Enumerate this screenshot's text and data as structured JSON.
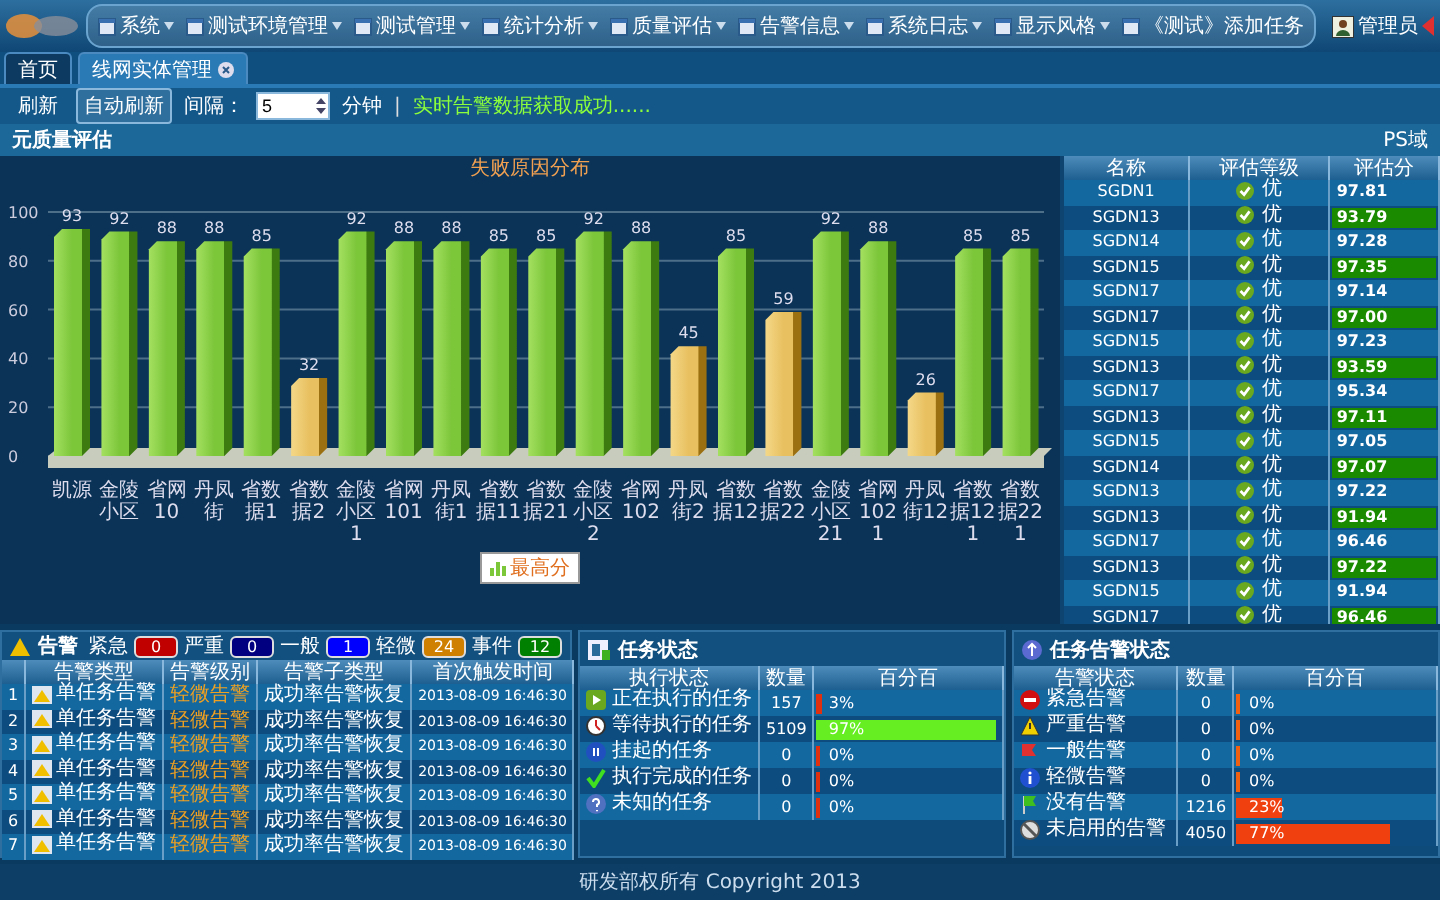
{
  "header": {
    "menu": [
      {
        "label": "系统",
        "dropdown": true
      },
      {
        "label": "测试环境管理",
        "dropdown": true
      },
      {
        "label": "测试管理",
        "dropdown": true
      },
      {
        "label": "统计分析",
        "dropdown": true
      },
      {
        "label": "质量评估",
        "dropdown": true
      },
      {
        "label": "告警信息",
        "dropdown": true
      },
      {
        "label": "系统日志",
        "dropdown": true
      },
      {
        "label": "显示风格",
        "dropdown": true
      },
      {
        "label": "《测试》添加任务",
        "dropdown": false
      }
    ],
    "user": "管理员"
  },
  "tabs": [
    {
      "label": "首页",
      "selected": false,
      "closable": false
    },
    {
      "label": "线网实体管理",
      "selected": true,
      "closable": true
    }
  ],
  "toolbar": {
    "refresh": "刷新",
    "auto_refresh": "自动刷新",
    "interval_label": "间隔：",
    "interval_value": "5",
    "unit": "分钟",
    "separator": "|",
    "status": "实时告警数据获取成功......"
  },
  "quality": {
    "title": "元质量评估",
    "domain": "PS域",
    "chart_data": {
      "type": "bar",
      "title": "失败原因分布",
      "categories": [
        "凯源",
        "金陵小区",
        "省网10",
        "丹凤街",
        "省数据1",
        "省数据2",
        "金陵小区1",
        "省网101",
        "丹凤街1",
        "省数据11",
        "省数据21",
        "金陵小区2",
        "省网102",
        "丹凤街2",
        "省数据12",
        "省数据22",
        "金陵小区21",
        "省网1021",
        "丹凤街12",
        "省数据121",
        "省数据221"
      ],
      "series": [
        {
          "name": "最高分",
          "color": "#7cc63a",
          "values": [
            93,
            92,
            88,
            88,
            85,
            null,
            92,
            88,
            88,
            85,
            85,
            92,
            88,
            null,
            85,
            null,
            92,
            88,
            null,
            85,
            85
          ]
        },
        {
          "color": "#e8c060",
          "values": [
            null,
            null,
            null,
            null,
            null,
            32,
            null,
            null,
            null,
            null,
            null,
            null,
            null,
            45,
            null,
            59,
            null,
            null,
            26,
            null,
            null
          ]
        }
      ],
      "ylim": [
        0,
        100
      ],
      "yticks": [
        0,
        20,
        40,
        60,
        80,
        100
      ],
      "grid": true,
      "data_labels": true
    },
    "table": {
      "columns": [
        "名称",
        "评估等级",
        "评估分"
      ],
      "rows": [
        {
          "name": "SGDN1",
          "grade": "优",
          "score": "97.81",
          "highlight": false
        },
        {
          "name": "SGDN13",
          "grade": "优",
          "score": "93.79",
          "highlight": true
        },
        {
          "name": "SGDN14",
          "grade": "优",
          "score": "97.28",
          "highlight": false
        },
        {
          "name": "SGDN15",
          "grade": "优",
          "score": "97.35",
          "highlight": true
        },
        {
          "name": "SGDN17",
          "grade": "优",
          "score": "97.14",
          "highlight": false
        },
        {
          "name": "SGDN17",
          "grade": "优",
          "score": "97.00",
          "highlight": true
        },
        {
          "name": "SGDN15",
          "grade": "优",
          "score": "97.23",
          "highlight": false
        },
        {
          "name": "SGDN13",
          "grade": "优",
          "score": "93.59",
          "highlight": true
        },
        {
          "name": "SGDN17",
          "grade": "优",
          "score": "95.34",
          "highlight": false
        },
        {
          "name": "SGDN13",
          "grade": "优",
          "score": "97.11",
          "highlight": true
        },
        {
          "name": "SGDN15",
          "grade": "优",
          "score": "97.05",
          "highlight": false
        },
        {
          "name": "SGDN14",
          "grade": "优",
          "score": "97.07",
          "highlight": true
        },
        {
          "name": "SGDN13",
          "grade": "优",
          "score": "97.22",
          "highlight": false
        },
        {
          "name": "SGDN13",
          "grade": "优",
          "score": "91.94",
          "highlight": true
        },
        {
          "name": "SGDN17",
          "grade": "优",
          "score": "96.46",
          "highlight": false
        },
        {
          "name": "SGDN13",
          "grade": "优",
          "score": "97.22",
          "highlight": true
        },
        {
          "name": "SGDN15",
          "grade": "优",
          "score": "91.94",
          "highlight": false
        },
        {
          "name": "SGDN17",
          "grade": "优",
          "score": "96.46",
          "highlight": true
        }
      ]
    }
  },
  "alarms": {
    "title": "告警",
    "levels": [
      {
        "label": "紧急",
        "count": "0",
        "color": "#c00000"
      },
      {
        "label": "严重",
        "count": "0",
        "color": "#000080"
      },
      {
        "label": "一般",
        "count": "1",
        "color": "#0000ff"
      },
      {
        "label": "轻微",
        "count": "24",
        "color": "#d08000"
      },
      {
        "label": "事件",
        "count": "12",
        "color": "#008000"
      }
    ],
    "columns": [
      "告警类型",
      "告警级别",
      "告警子类型",
      "首次触发时间"
    ],
    "rows": [
      {
        "index": "1",
        "type": "单任务告警",
        "level": "轻微告警",
        "subtype": "成功率告警恢复",
        "time": "2013-08-09 16:46:30"
      },
      {
        "index": "2",
        "type": "单任务告警",
        "level": "轻微告警",
        "subtype": "成功率告警恢复",
        "time": "2013-08-09 16:46:30"
      },
      {
        "index": "3",
        "type": "单任务告警",
        "level": "轻微告警",
        "subtype": "成功率告警恢复",
        "time": "2013-08-09 16:46:30"
      },
      {
        "index": "4",
        "type": "单任务告警",
        "level": "轻微告警",
        "subtype": "成功率告警恢复",
        "time": "2013-08-09 16:46:30"
      },
      {
        "index": "5",
        "type": "单任务告警",
        "level": "轻微告警",
        "subtype": "成功率告警恢复",
        "time": "2013-08-09 16:46:30"
      },
      {
        "index": "6",
        "type": "单任务告警",
        "level": "轻微告警",
        "subtype": "成功率告警恢复",
        "time": "2013-08-09 16:46:30"
      },
      {
        "index": "7",
        "type": "单任务告警",
        "level": "轻微告警",
        "subtype": "成功率告警恢复",
        "time": "2013-08-09 16:46:30"
      }
    ]
  },
  "tasks": {
    "title": "任务状态",
    "columns": [
      "执行状态",
      "数量",
      "百分百"
    ],
    "rows": [
      {
        "state": "正在执行的任务",
        "count": "157",
        "percent": "3%",
        "level": 0.03,
        "color": "#e03010"
      },
      {
        "state": "等待执行的任务",
        "count": "5109",
        "percent": "97%",
        "level": 0.97,
        "color": "#66ee22"
      },
      {
        "state": "挂起的任务",
        "count": "0",
        "percent": "0%",
        "level": 0,
        "color": "#e03010"
      },
      {
        "state": "执行完成的任务",
        "count": "0",
        "percent": "0%",
        "level": 0,
        "color": "#e03010"
      },
      {
        "state": "未知的任务",
        "count": "0",
        "percent": "0%",
        "level": 0,
        "color": "#e03010"
      }
    ]
  },
  "task_alarms": {
    "title": "任务告警状态",
    "columns": [
      "告警状态",
      "数量",
      "百分百"
    ],
    "rows": [
      {
        "state": "紧急告警",
        "count": "0",
        "percent": "0%",
        "level": 0,
        "color": "#f06010"
      },
      {
        "state": "严重告警",
        "count": "0",
        "percent": "0%",
        "level": 0,
        "color": "#f06010"
      },
      {
        "state": "一般告警",
        "count": "0",
        "percent": "0%",
        "level": 0,
        "color": "#f06010"
      },
      {
        "state": "轻微告警",
        "count": "0",
        "percent": "0%",
        "level": 0,
        "color": "#f06010"
      },
      {
        "state": "没有告警",
        "count": "1216",
        "percent": "23%",
        "level": 0.23,
        "color": "#f04010"
      },
      {
        "state": "未启用的告警",
        "count": "4050",
        "percent": "77%",
        "level": 0.77,
        "color": "#f04010"
      }
    ]
  },
  "footer": "研发部权所有 Copyright 2013"
}
